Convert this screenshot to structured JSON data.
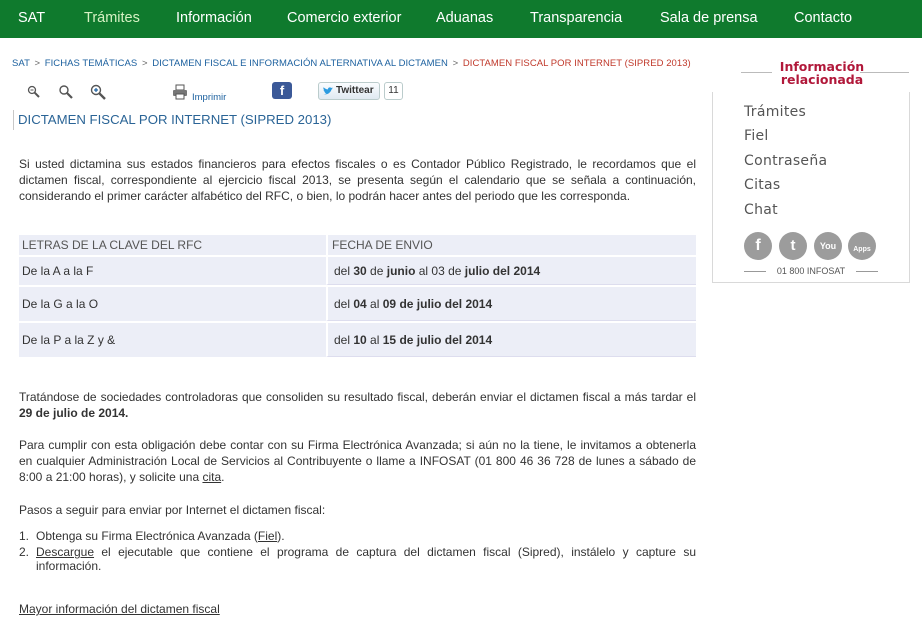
{
  "nav": {
    "items": [
      "SAT",
      "Trámites",
      "Información",
      "Comercio exterior",
      "Aduanas",
      "Transparencia",
      "Sala de prensa",
      "Contacto"
    ]
  },
  "breadcrumb": {
    "items": [
      "SAT",
      "FICHAS TEMÁTICAS",
      "DICTAMEN FISCAL E INFORMACIÓN ALTERNATIVA AL DICTAMEN"
    ],
    "separator": ">",
    "current": "DICTAMEN FISCAL POR INTERNET (SIPRED 2013)"
  },
  "toolbar": {
    "print_label": "Imprimir",
    "facebook_glyph": "f",
    "tweet_label": "Twittear",
    "tweet_count": "11",
    "icons": [
      "font-decrease-icon",
      "font-normal-icon",
      "font-increase-icon",
      "printer-icon",
      "facebook-icon",
      "twitter-bird-icon"
    ]
  },
  "page": {
    "title": "DICTAMEN FISCAL POR INTERNET (SIPRED 2013)",
    "intro": "Si usted dictamina sus estados financieros para efectos fiscales o es Contador Público Registrado, le recordamos que el dictamen fiscal, correspondiente al ejercicio fiscal 2013, se presenta según el calendario que se señala a continuación, considerando el primer carácter alfabético del RFC, o bien, lo podrán hacer antes del periodo que les corresponda.",
    "table": {
      "headers": [
        "LETRAS DE LA CLAVE DEL RFC",
        "FECHA DE ENVIO"
      ],
      "rows": [
        {
          "letters": "De la A a la F",
          "pre": "del ",
          "d1": "30",
          "m1_pre": " de ",
          "m1": "junio",
          "mid": " al ",
          "d2": "03",
          "m2_pre": " de ",
          "m2": "julio del 2014"
        },
        {
          "letters": "De la G a la O",
          "pre": "del ",
          "d1": "04",
          "m1_pre": "",
          "m1": "",
          "mid": " al ",
          "d2": "09",
          "m2_pre": " ",
          "m2": "de julio del 2014"
        },
        {
          "letters": "De la P a la Z y &",
          "pre": "del ",
          "d1": "10",
          "m1_pre": "",
          "m1": "",
          "mid": " al ",
          "d2": "15",
          "m2_pre": " ",
          "m2": "de julio del 2014"
        }
      ]
    },
    "controladoras_text": "Tratándose de sociedades controladoras que consoliden su resultado fiscal, deberán enviar el dictamen fiscal  a más tardar el ",
    "controladoras_date": "29 de julio de 2014.",
    "fiel_text": "Para cumplir con esta obligación debe contar con su Firma Electrónica Avanzada; si aún no la tiene, le invitamos a obtenerla en cualquier Administración Local de Servicios  al Contribuyente o llame a INFOSAT (01 800 46 36 728 de lunes a sábado de 8:00 a 21:00 horas), y solicite una ",
    "fiel_link": "cita",
    "fiel_end": ".",
    "steps_intro": "Pasos a seguir para enviar por Internet el dictamen fiscal:",
    "steps": [
      {
        "num": "1.",
        "pre": "Obtenga su Firma Electrónica Avanzada (",
        "link": "Fiel",
        "post": ")."
      },
      {
        "num": "2.",
        "pre": "",
        "link": "Descargue",
        "post": " el ejecutable que contiene el  programa de captura del dictamen fiscal (Sipred), instálelo y capture su información."
      }
    ],
    "more_link": "Mayor información del dictamen fiscal"
  },
  "sidebar": {
    "title_line1": "Información",
    "title_line2": "relacionada",
    "links": [
      "Trámites",
      "Fiel",
      "Contraseña",
      "Citas",
      "Chat"
    ],
    "social": [
      {
        "icon": "facebook-icon",
        "glyph": "f"
      },
      {
        "icon": "twitter-icon",
        "glyph": "t"
      },
      {
        "icon": "youtube-icon",
        "glyph": "You"
      },
      {
        "icon": "apps-icon",
        "glyph": "Apps"
      }
    ],
    "phone": "01 800 INFOSAT"
  }
}
